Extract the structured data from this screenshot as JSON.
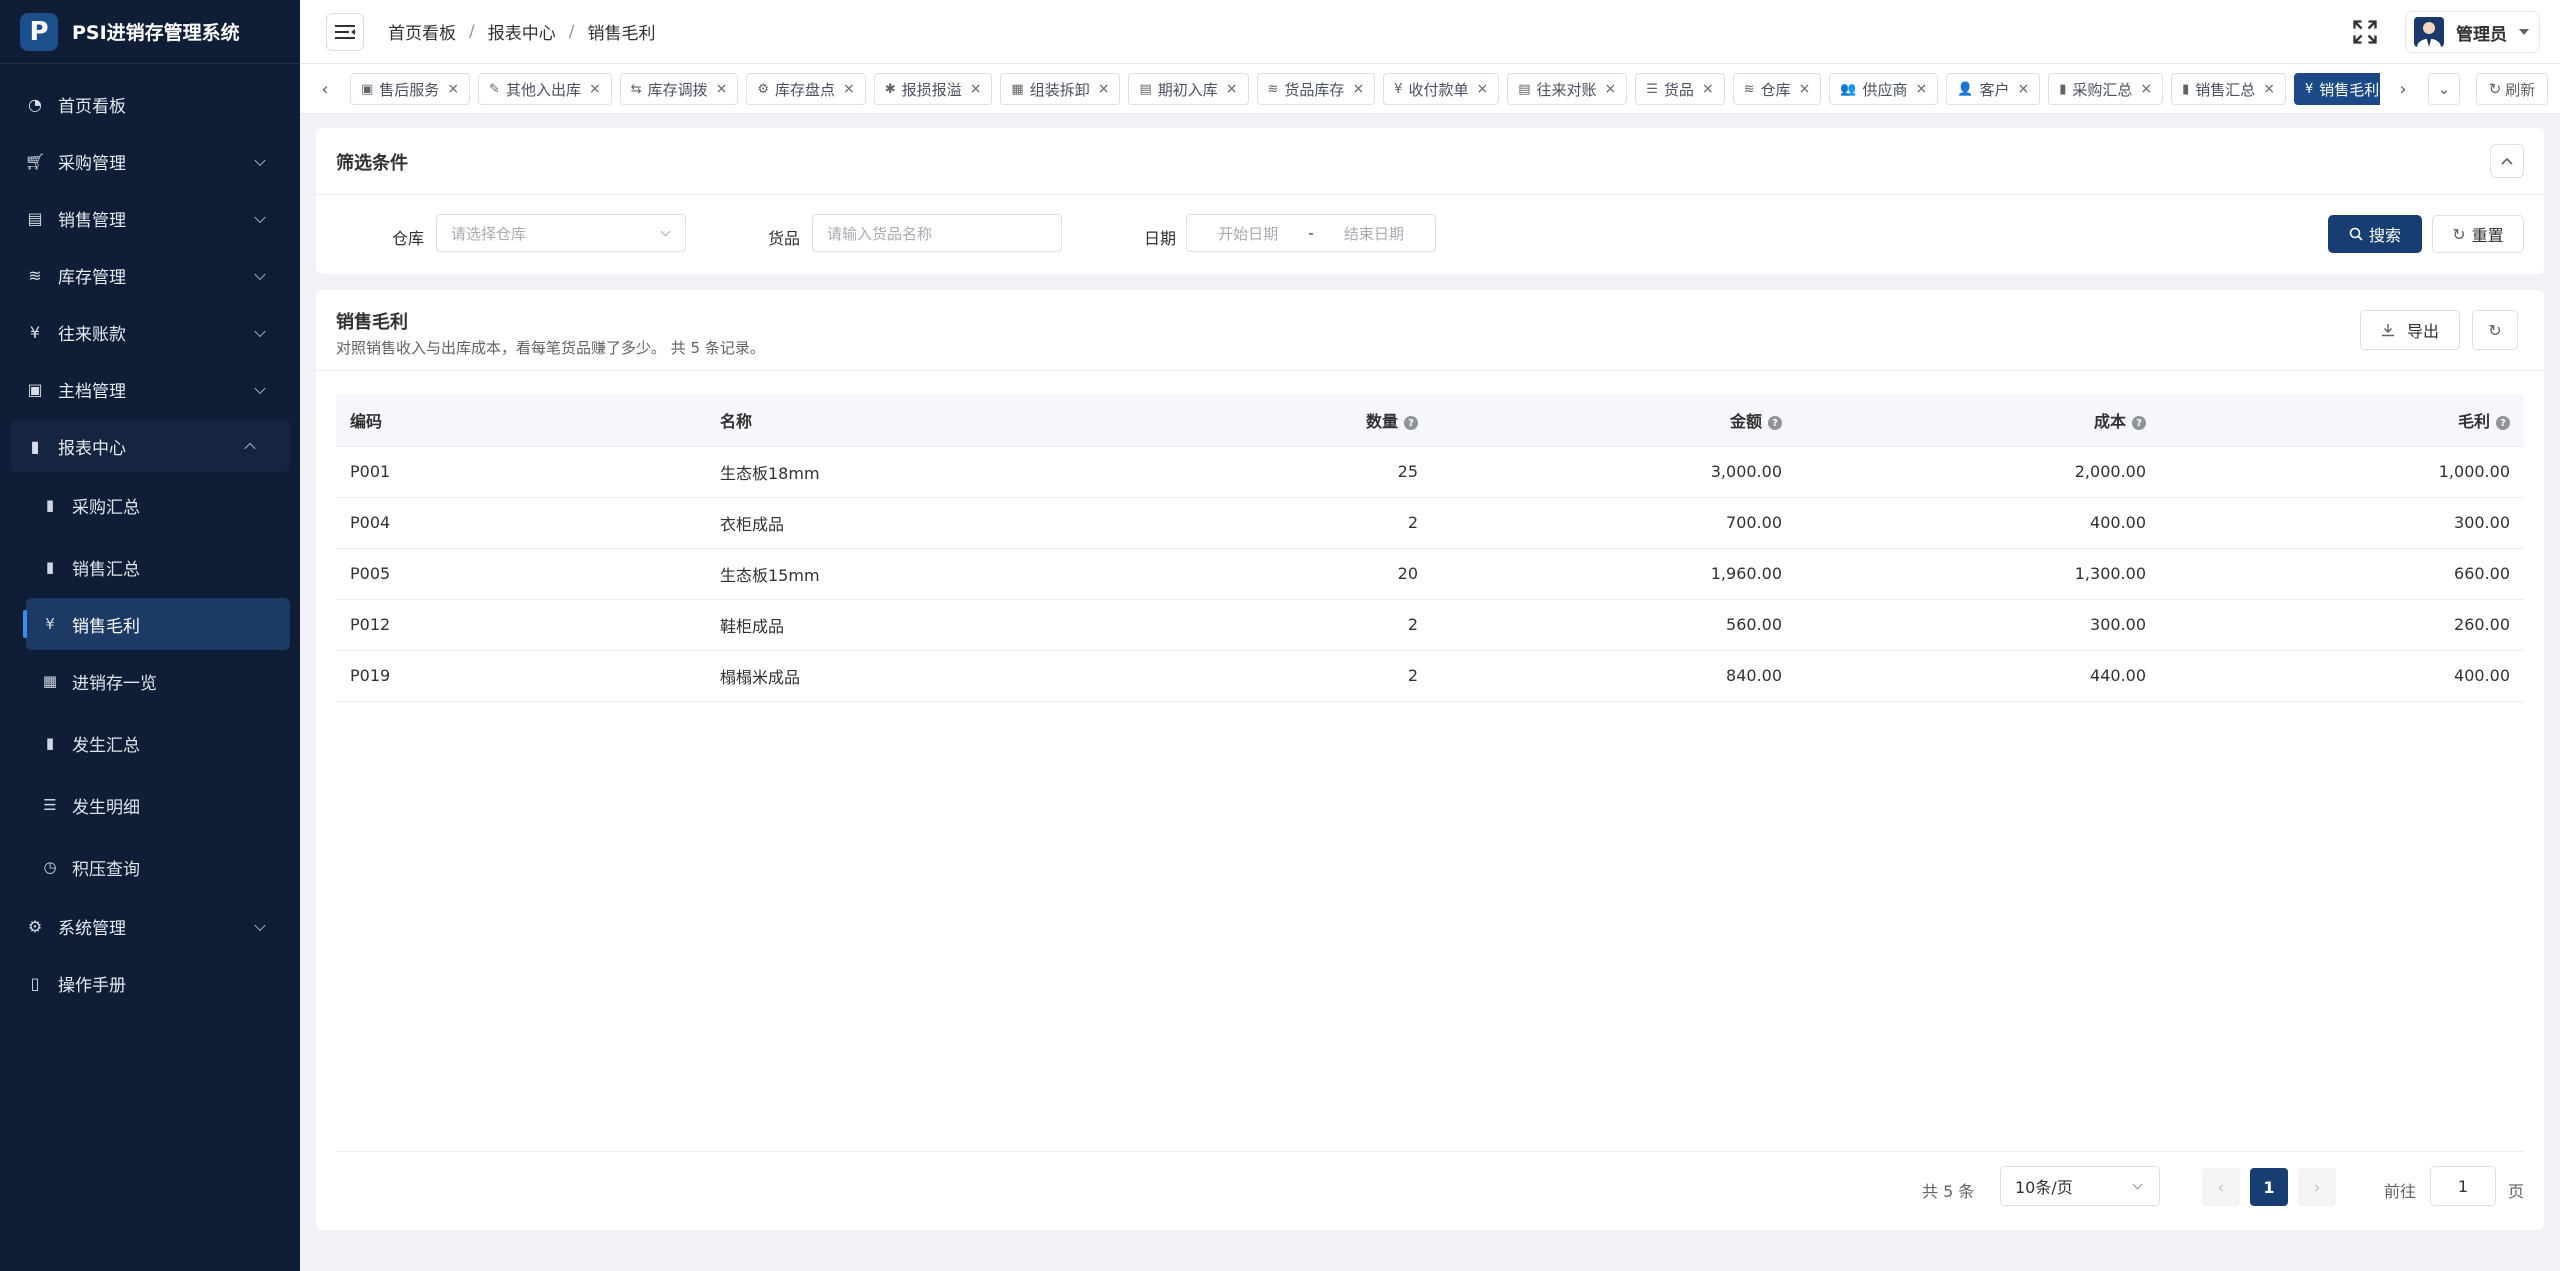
{
  "app": {
    "logo": "P",
    "title": "PSI进销存管理系统"
  },
  "sidebar": {
    "items": [
      {
        "label": "首页看板",
        "icon": "dashboard-icon"
      },
      {
        "label": "采购管理",
        "icon": "cart-icon"
      },
      {
        "label": "销售管理",
        "icon": "sales-icon"
      },
      {
        "label": "库存管理",
        "icon": "stack-icon"
      },
      {
        "label": "往来账款",
        "icon": "yen-icon"
      },
      {
        "label": "主档管理",
        "icon": "archive-icon"
      },
      {
        "label": "报表中心",
        "icon": "bar-chart-icon"
      },
      {
        "label": "系统管理",
        "icon": "gear-icon"
      },
      {
        "label": "操作手册",
        "icon": "book-icon"
      }
    ],
    "report_children": [
      {
        "label": "采购汇总",
        "icon": "bar-chart-icon"
      },
      {
        "label": "销售汇总",
        "icon": "bar-chart-icon"
      },
      {
        "label": "销售毛利",
        "icon": "yen-icon"
      },
      {
        "label": "进销存一览",
        "icon": "table-icon"
      },
      {
        "label": "发生汇总",
        "icon": "bar-chart-icon"
      },
      {
        "label": "发生明细",
        "icon": "list-icon"
      },
      {
        "label": "积压查询",
        "icon": "clock-icon"
      }
    ]
  },
  "header": {
    "breadcrumbs": [
      "首页看板",
      "报表中心",
      "销售毛利"
    ],
    "separator": "/",
    "user": "管理员"
  },
  "tabs": [
    {
      "label": "售后服务",
      "icon": "▣"
    },
    {
      "label": "其他入出库",
      "icon": "✎"
    },
    {
      "label": "库存调拨",
      "icon": "⇆"
    },
    {
      "label": "库存盘点",
      "icon": "⚙"
    },
    {
      "label": "报损报溢",
      "icon": "✱"
    },
    {
      "label": "组装拆卸",
      "icon": "▦"
    },
    {
      "label": "期初入库",
      "icon": "▤"
    },
    {
      "label": "货品库存",
      "icon": "≋"
    },
    {
      "label": "收付款单",
      "icon": "¥"
    },
    {
      "label": "往来对账",
      "icon": "▤"
    },
    {
      "label": "货品",
      "icon": "☰"
    },
    {
      "label": "仓库",
      "icon": "≋"
    },
    {
      "label": "供应商",
      "icon": "👥"
    },
    {
      "label": "客户",
      "icon": "👤"
    },
    {
      "label": "采购汇总",
      "icon": "▮"
    },
    {
      "label": "销售汇总",
      "icon": "▮"
    },
    {
      "label": "销售毛利",
      "icon": "¥"
    }
  ],
  "tab_tools": {
    "close": "×",
    "refresh_label": "刷新"
  },
  "filter": {
    "title": "筛选条件",
    "warehouse_label": "仓库",
    "warehouse_placeholder": "请选择仓库",
    "goods_label": "货品",
    "goods_placeholder": "请输入货品名称",
    "date_label": "日期",
    "date_start": "开始日期",
    "date_sep": "-",
    "date_end": "结束日期",
    "search": "搜索",
    "reset": "重置"
  },
  "table": {
    "title": "销售毛利",
    "subtitle": "对照销售收入与出库成本，看每笔货品赚了多少。 共 5 条记录。",
    "export": "导出",
    "columns": [
      "编码",
      "名称",
      "数量",
      "金额",
      "成本",
      "毛利"
    ],
    "rows": [
      [
        "P001",
        "生态板18mm",
        "25",
        "3,000.00",
        "2,000.00",
        "1,000.00"
      ],
      [
        "P004",
        "衣柜成品",
        "2",
        "700.00",
        "400.00",
        "300.00"
      ],
      [
        "P005",
        "生态板15mm",
        "20",
        "1,960.00",
        "1,300.00",
        "660.00"
      ],
      [
        "P012",
        "鞋柜成品",
        "2",
        "560.00",
        "300.00",
        "260.00"
      ],
      [
        "P019",
        "榻榻米成品",
        "2",
        "840.00",
        "440.00",
        "400.00"
      ]
    ]
  },
  "pagination": {
    "total": "共 5 条",
    "page_size": "10条/页",
    "current": "1",
    "goto_label": "前往",
    "goto_value": "1",
    "unit": "页"
  },
  "colors": {
    "sidebar_bg": "#0f1e36",
    "primary": "#173d72",
    "active_tab": "#1b4a86"
  }
}
